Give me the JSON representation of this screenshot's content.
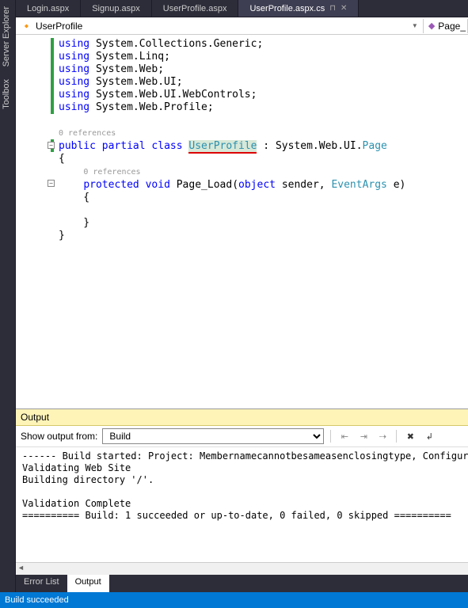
{
  "sideTabs": [
    "Server Explorer",
    "Toolbox"
  ],
  "docTabs": [
    {
      "label": "Login.aspx",
      "active": false
    },
    {
      "label": "Signup.aspx",
      "active": false
    },
    {
      "label": "UserProfile.aspx",
      "active": false
    },
    {
      "label": "UserProfile.aspx.cs",
      "active": true
    }
  ],
  "nav": {
    "left": "UserProfile",
    "right": "Page_"
  },
  "code": {
    "usings": [
      "System.Collections.Generic",
      "System.Linq",
      "System.Web",
      "System.Web.UI",
      "System.Web.UI.WebControls",
      "System.Web.Profile"
    ],
    "codelens1": "0 references",
    "codelens2": "0 references",
    "className": "UserProfile",
    "baseNs": "System.Web.UI.",
    "baseType": "Page",
    "method": "Page_Load",
    "paramType1": "object",
    "paramName1": "sender",
    "paramType2": "EventArgs",
    "paramName2": "e",
    "kw_using": "using",
    "kw_public": "public",
    "kw_partial": "partial",
    "kw_class": "class",
    "kw_protected": "protected",
    "kw_void": "void"
  },
  "output": {
    "title": "Output",
    "label": "Show output from:",
    "source": "Build",
    "text": "------ Build started: Project: Membernamecannotbesameasenclosingtype, Configura\nValidating Web Site\nBuilding directory '/'.\n\nValidation Complete\n========== Build: 1 succeeded or up-to-date, 0 failed, 0 skipped ==========\n"
  },
  "bottomTabs": [
    {
      "label": "Error List",
      "active": false
    },
    {
      "label": "Output",
      "active": true
    }
  ],
  "status": "Build succeeded"
}
